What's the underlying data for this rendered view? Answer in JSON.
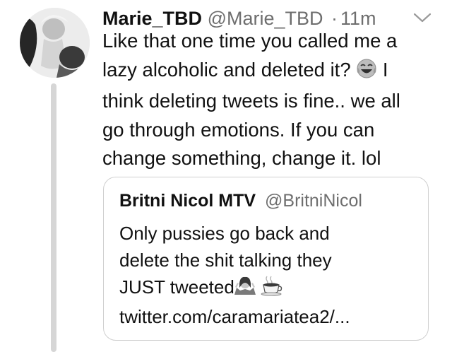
{
  "tweet": {
    "author_name": "Marie_TBD",
    "author_handle": "@Marie_TBD",
    "separator": "·",
    "time": "11m",
    "lines": [
      "Like that one time you called me a",
      "lazy alcoholic and deleted it?",
      "I",
      "think deleting tweets is fine.. we all",
      "go through emotions. If you can",
      "change something, change it. lol"
    ],
    "icons": {
      "menu": "chevron-down-icon",
      "emoji": "tears-of-joy-emoji"
    }
  },
  "quoted_tweet": {
    "author_name": "Britni Nicol MTV",
    "author_handle": "@BritniNicol",
    "lines": [
      "Only pussies go back and",
      "delete the shit talking they",
      "JUST tweeted",
      "twitter.com/caramariatea2/..."
    ],
    "icons": [
      "woman-shrugging-emoji",
      "coffee-cup-emoji"
    ]
  }
}
